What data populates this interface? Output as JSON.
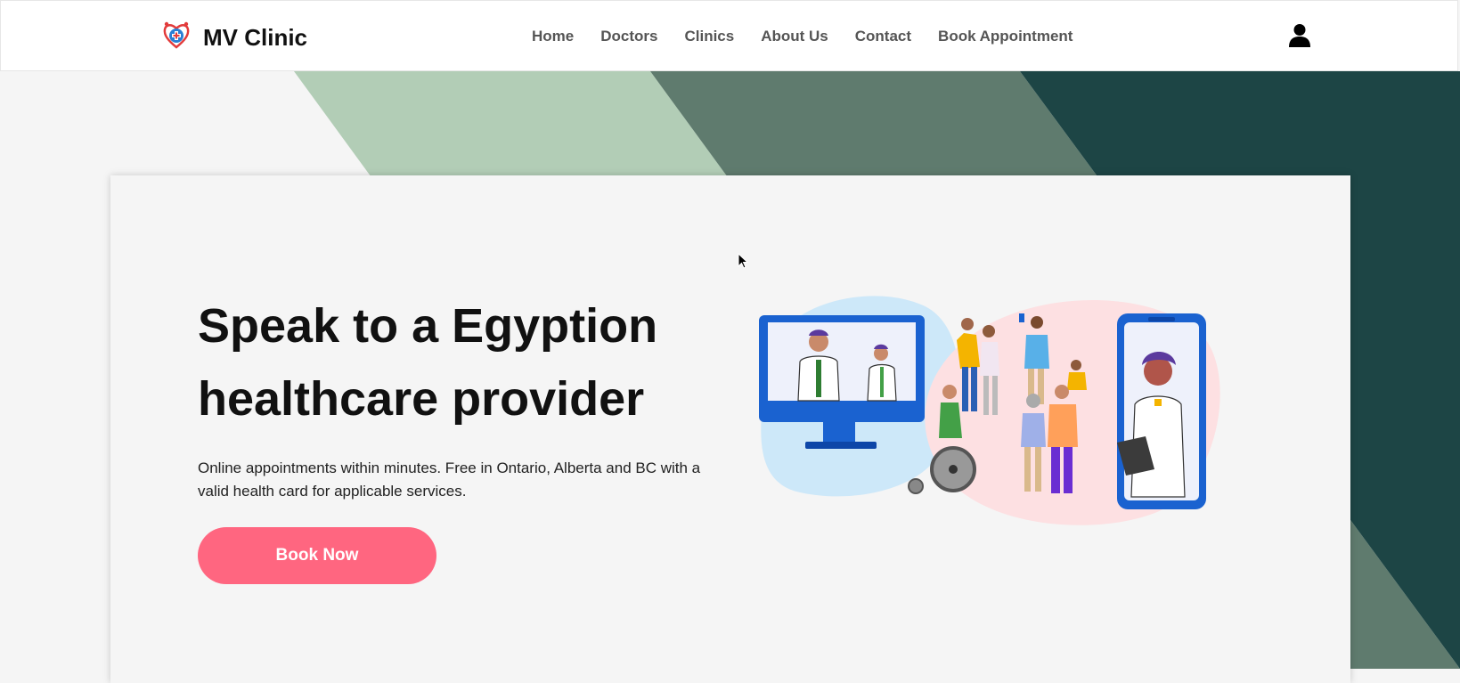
{
  "brand": {
    "name": "MV Clinic",
    "logo_icon": "heart-cross-logo-icon"
  },
  "nav": {
    "items": [
      {
        "label": "Home"
      },
      {
        "label": "Doctors"
      },
      {
        "label": "Clinics"
      },
      {
        "label": "About Us"
      },
      {
        "label": "Contact"
      },
      {
        "label": "Book Appointment"
      }
    ],
    "user_icon": "user-icon"
  },
  "hero": {
    "title_line1": "Speak to a Egyption",
    "title_line2": "healthcare provider",
    "description": "Online appointments within minutes. Free in Ontario, Alberta and BC with a valid health card for applicable services.",
    "cta_label": "Book Now",
    "illustration_icon": "telehealth-illustration-icon"
  },
  "colors": {
    "band_light": "#b2cdb6",
    "band_mid": "#5f7b6e",
    "band_dark": "#1d4545",
    "cta": "#ff6680",
    "nav_text": "#555555"
  }
}
